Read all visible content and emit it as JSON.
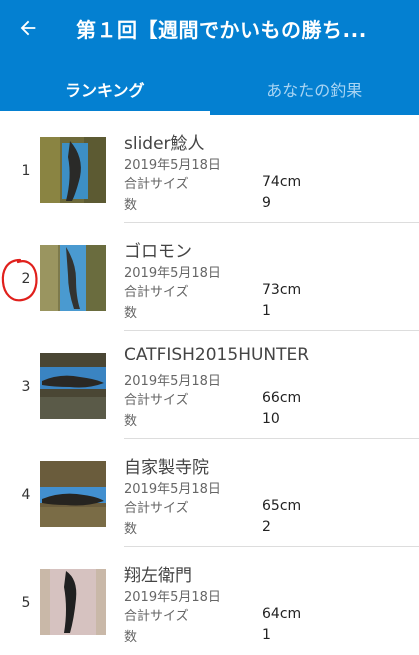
{
  "header": {
    "title": "第１回【週間でかいもの勝ち...",
    "back_icon": "arrow-left-icon",
    "background": "#0480d1"
  },
  "tabs": [
    {
      "label": "ランキング",
      "active": true
    },
    {
      "label": "あなたの釣果",
      "active": false
    }
  ],
  "ranking": [
    {
      "rank": "1",
      "name": "slider鯰人",
      "date": "2019年5月18日",
      "size_label": "合計サイズ",
      "size": "74cm",
      "count_label": "数",
      "count": "9"
    },
    {
      "rank": "2",
      "name": "ゴロモン",
      "date": "2019年5月18日",
      "size_label": "合計サイズ",
      "size": "73cm",
      "count_label": "数",
      "count": "1"
    },
    {
      "rank": "3",
      "name": "CATFISH2015HUNTER",
      "date": "2019年5月18日",
      "size_label": "合計サイズ",
      "size": "66cm",
      "count_label": "数",
      "count": "10"
    },
    {
      "rank": "4",
      "name": "自家製寺院",
      "date": "2019年5月18日",
      "size_label": "合計サイズ",
      "size": "65cm",
      "count_label": "数",
      "count": "2"
    },
    {
      "rank": "5",
      "name": "翔左衛門",
      "date": "2019年5月18日",
      "size_label": "合計サイズ",
      "size": "64cm",
      "count_label": "数",
      "count": "1"
    }
  ]
}
